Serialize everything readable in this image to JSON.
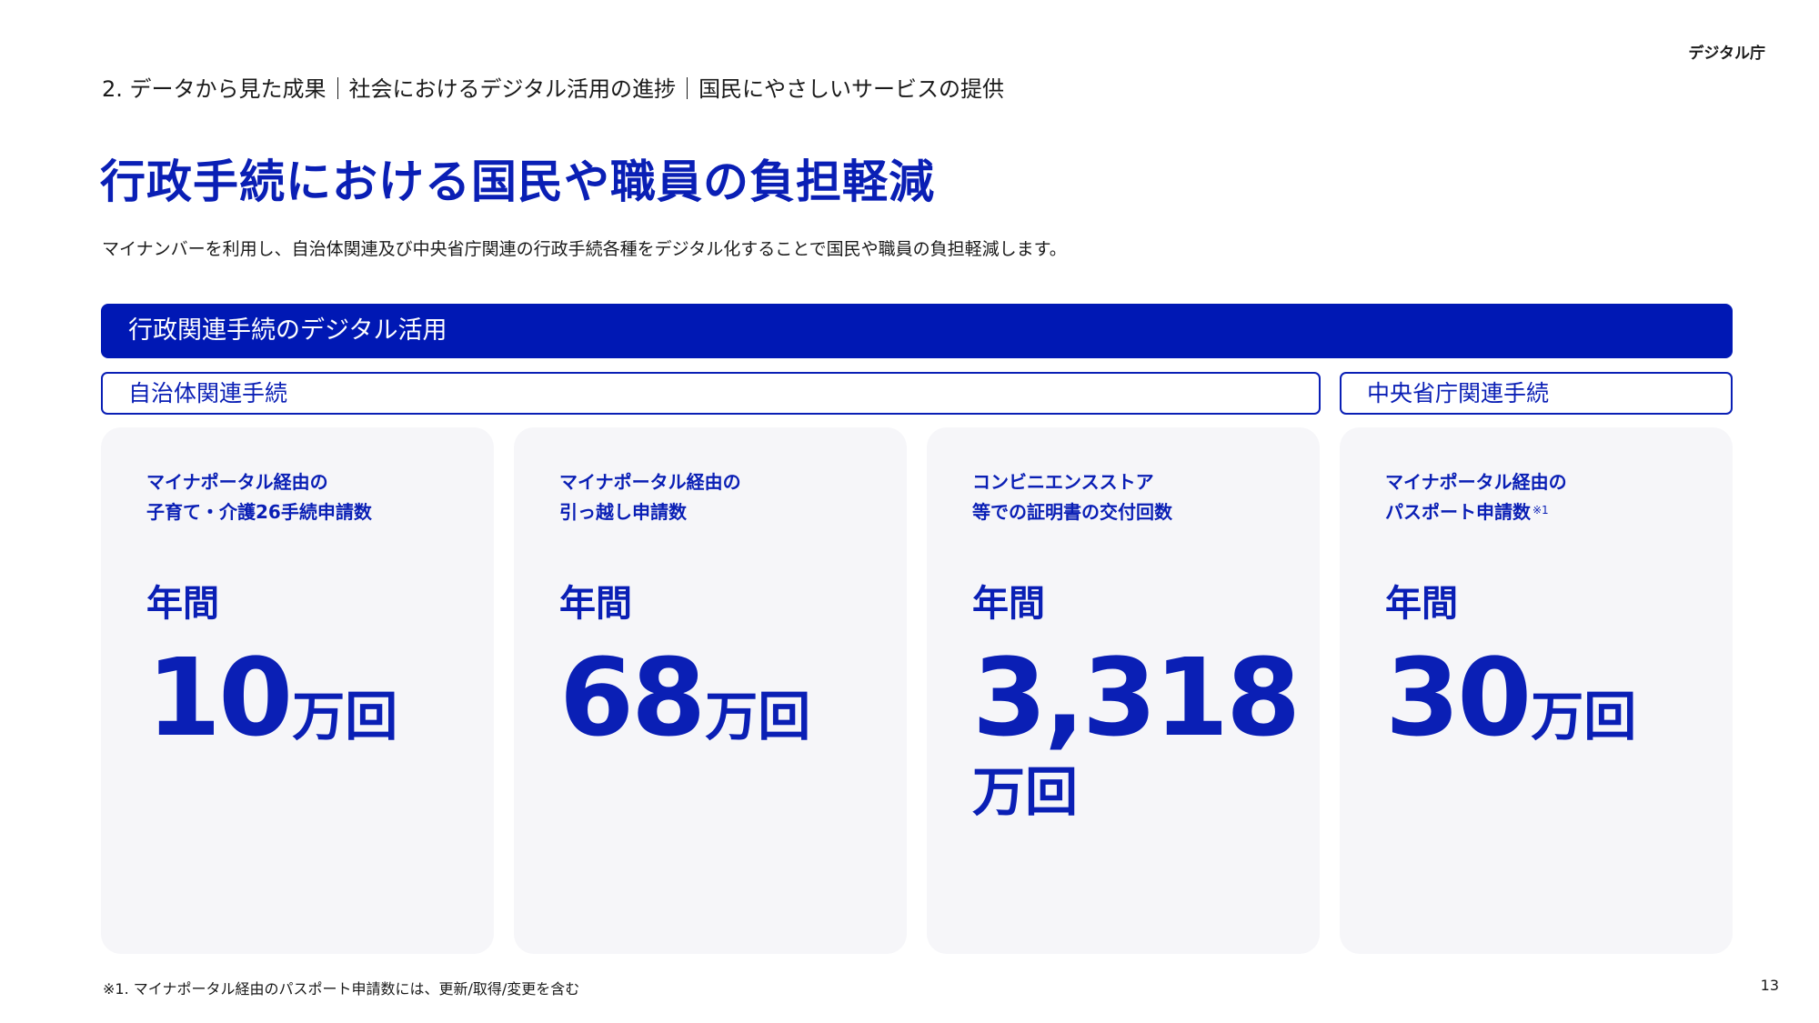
{
  "header": {
    "logo_text": "デジタル庁",
    "breadcrumb": [
      "2. データから見た成果",
      "社会におけるデジタル活用の進捗",
      "国民にやさしいサービスの提供"
    ]
  },
  "title": "行政手続における国民や職員の負担軽減",
  "lead": "マイナンバーを利用し、自治体関連及び中央省庁関連の行政手続各種をデジタル化することで国民や職員の負担軽減します。",
  "section_title": "行政関連手続のデジタル活用",
  "groups": {
    "local": "自治体関連手続",
    "central": "中央省庁関連手続"
  },
  "cards": [
    {
      "label_line1": "マイナポータル経由の",
      "label_line2": "子育て・介護26手続申請数",
      "note_mark": "",
      "annual": "年間",
      "value": "10",
      "unit": "万回"
    },
    {
      "label_line1": "マイナポータル経由の",
      "label_line2": "引っ越し申請数",
      "note_mark": "",
      "annual": "年間",
      "value": "68",
      "unit": "万回"
    },
    {
      "label_line1": "コンビニエンスストア",
      "label_line2": "等での証明書の交付回数",
      "note_mark": "",
      "annual": "年間",
      "value": "3,318",
      "unit": "万回"
    },
    {
      "label_line1": "マイナポータル経由の",
      "label_line2": "パスポート申請数",
      "note_mark": "※1",
      "annual": "年間",
      "value": "30",
      "unit": "万回"
    }
  ],
  "colors": {
    "accent": "#0a1fb5",
    "bar": "#0018b4",
    "card_bg": "#f6f6f9"
  },
  "footnote": "※1. マイナポータル経由のパスポート申請数には、更新/取得/変更を含む",
  "page_number": "13"
}
